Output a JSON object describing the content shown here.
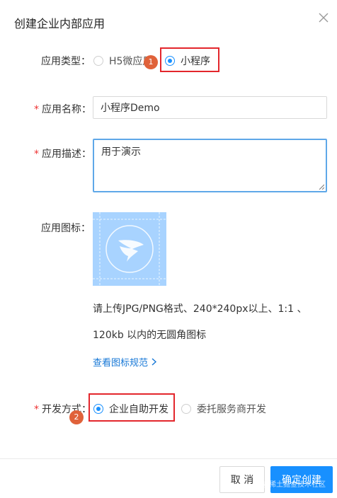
{
  "dialog": {
    "title": "创建企业内部应用"
  },
  "form": {
    "app_type": {
      "label": "应用类型：",
      "options": [
        {
          "label": "H5微应用",
          "selected": false
        },
        {
          "label": "小程序",
          "selected": true
        }
      ]
    },
    "app_name": {
      "required_mark": "*",
      "label": "应用名称：",
      "value": "小程序Demo"
    },
    "app_desc": {
      "required_mark": "*",
      "label": "应用描述：",
      "value": "用于演示"
    },
    "app_icon": {
      "label": "应用图标：",
      "hint_line1": "请上传JPG/PNG格式、240*240px以上、1:1 、",
      "hint_line2": "120kb 以内的无圆角图标",
      "spec_link": "查看图标规范"
    },
    "dev_mode": {
      "required_mark": "*",
      "label": "开发方式：",
      "options": [
        {
          "label": "企业自助开发",
          "selected": true
        },
        {
          "label": "委托服务商开发",
          "selected": false
        }
      ]
    }
  },
  "annotations": {
    "step1": "1",
    "step2": "2"
  },
  "footer": {
    "cancel": "取 消",
    "confirm": "确定创建",
    "watermark": "@稀土掘金技术社区"
  },
  "colors": {
    "primary": "#1890ff",
    "highlight": "#e3262c",
    "step_badge": "#e0623a",
    "required": "#e33333"
  }
}
